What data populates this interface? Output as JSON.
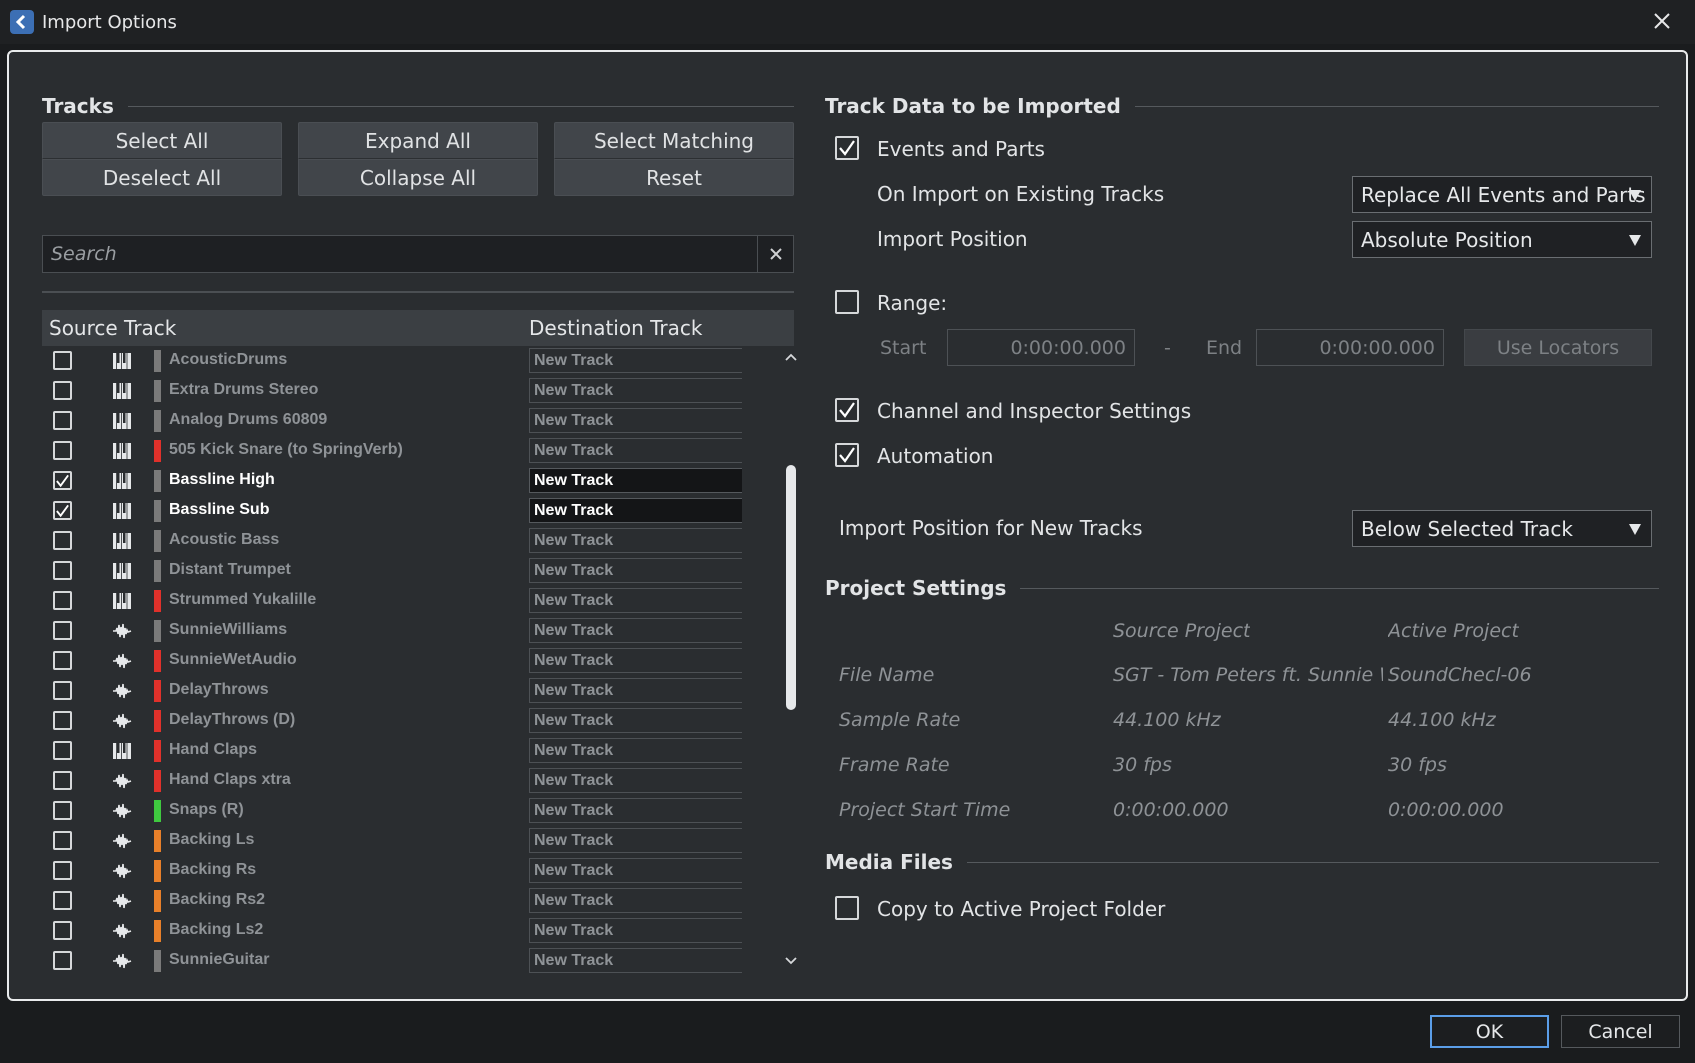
{
  "window": {
    "title": "Import Options"
  },
  "tracks_section": {
    "header": "Tracks",
    "buttons": {
      "select_all": "Select All",
      "deselect_all": "Deselect All",
      "expand_all": "Expand All",
      "collapse_all": "Collapse All",
      "select_matching": "Select Matching",
      "reset": "Reset"
    },
    "search": {
      "placeholder": "Search",
      "value": ""
    },
    "columns": {
      "source": "Source Track",
      "destination": "Destination Track"
    },
    "rows": [
      {
        "name": "AcousticDrums",
        "type": "midi",
        "color": "#7a7a7a",
        "checked": false,
        "dest": "New Track"
      },
      {
        "name": "Extra Drums Stereo",
        "type": "midi",
        "color": "#7a7a7a",
        "checked": false,
        "dest": "New Track"
      },
      {
        "name": "Analog Drums 60809",
        "type": "midi",
        "color": "#7a7a7a",
        "checked": false,
        "dest": "New Track"
      },
      {
        "name": "505 Kick Snare (to SpringVerb)",
        "type": "midi",
        "color": "#e0312b",
        "checked": false,
        "dest": "New Track"
      },
      {
        "name": "Bassline High",
        "type": "midi",
        "color": "#7a7a7a",
        "checked": true,
        "dest": "New Track"
      },
      {
        "name": "Bassline Sub",
        "type": "midi",
        "color": "#7a7a7a",
        "checked": true,
        "dest": "New Track"
      },
      {
        "name": "Acoustic Bass",
        "type": "midi",
        "color": "#7a7a7a",
        "checked": false,
        "dest": "New Track"
      },
      {
        "name": "Distant Trumpet",
        "type": "midi",
        "color": "#7a7a7a",
        "checked": false,
        "dest": "New Track"
      },
      {
        "name": "Strummed Yukalille",
        "type": "midi",
        "color": "#e0312b",
        "checked": false,
        "dest": "New Track"
      },
      {
        "name": "SunnieWilliams",
        "type": "audio",
        "color": "#7a7a7a",
        "checked": false,
        "dest": "New Track"
      },
      {
        "name": "SunnieWetAudio",
        "type": "audio",
        "color": "#e0312b",
        "checked": false,
        "dest": "New Track"
      },
      {
        "name": "DelayThrows",
        "type": "audio",
        "color": "#e0312b",
        "checked": false,
        "dest": "New Track"
      },
      {
        "name": "DelayThrows (D)",
        "type": "audio",
        "color": "#e0312b",
        "checked": false,
        "dest": "New Track"
      },
      {
        "name": "Hand Claps",
        "type": "midi",
        "color": "#e0312b",
        "checked": false,
        "dest": "New Track"
      },
      {
        "name": "Hand Claps xtra",
        "type": "audio",
        "color": "#e0312b",
        "checked": false,
        "dest": "New Track"
      },
      {
        "name": "Snaps (R)",
        "type": "audio",
        "color": "#3fc93f",
        "checked": false,
        "dest": "New Track"
      },
      {
        "name": "Backing Ls",
        "type": "audio",
        "color": "#e8802a",
        "checked": false,
        "dest": "New Track"
      },
      {
        "name": "Backing Rs",
        "type": "audio",
        "color": "#e8802a",
        "checked": false,
        "dest": "New Track"
      },
      {
        "name": "Backing Rs2",
        "type": "audio",
        "color": "#e8802a",
        "checked": false,
        "dest": "New Track"
      },
      {
        "name": "Backing Ls2",
        "type": "audio",
        "color": "#e8802a",
        "checked": false,
        "dest": "New Track"
      },
      {
        "name": "SunnieGuitar",
        "type": "audio",
        "color": "#7a7a7a",
        "checked": false,
        "dest": "New Track"
      }
    ]
  },
  "track_data": {
    "header": "Track Data to be Imported",
    "events_and_parts": {
      "label": "Events and Parts",
      "checked": true
    },
    "on_import_existing": {
      "label": "On Import on Existing Tracks",
      "value": "Replace All Events and Parts"
    },
    "import_position": {
      "label": "Import Position",
      "value": "Absolute Position"
    },
    "range": {
      "label": "Range:",
      "checked": false,
      "start_label": "Start",
      "start_value": "0:00:00.000",
      "separator": "-",
      "end_label": "End",
      "end_value": "0:00:00.000",
      "use_locators": "Use Locators"
    },
    "channel_inspector": {
      "label": "Channel and Inspector Settings",
      "checked": true
    },
    "automation": {
      "label": "Automation",
      "checked": true
    },
    "new_tracks_position": {
      "label": "Import Position for New Tracks",
      "value": "Below Selected Track"
    }
  },
  "project_settings": {
    "header": "Project Settings",
    "col_source": "Source Project",
    "col_active": "Active Project",
    "rows": [
      {
        "label": "File Name",
        "source": "SGT - Tom Peters ft. Sunnie Wil",
        "active": "SoundChecl-06"
      },
      {
        "label": "Sample Rate",
        "source": "44.100 kHz",
        "active": "44.100 kHz"
      },
      {
        "label": "Frame Rate",
        "source": "30 fps",
        "active": "30 fps"
      },
      {
        "label": "Project Start Time",
        "source": "0:00:00.000",
        "active": "0:00:00.000"
      }
    ]
  },
  "media_files": {
    "header": "Media Files",
    "copy_to_folder": {
      "label": "Copy to Active Project Folder",
      "checked": false
    }
  },
  "footer": {
    "ok": "OK",
    "cancel": "Cancel"
  }
}
